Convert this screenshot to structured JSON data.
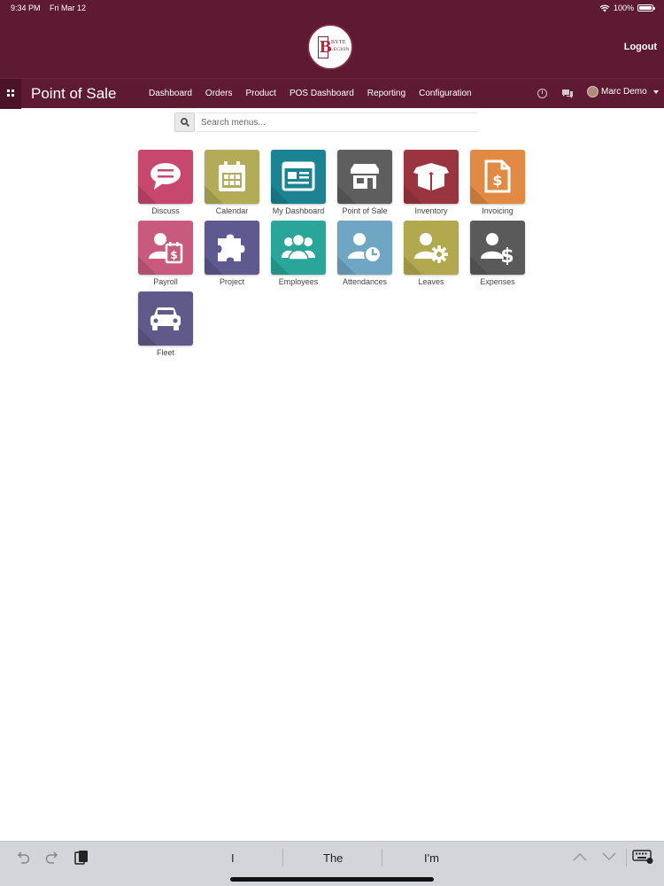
{
  "status": {
    "time": "9:34 PM",
    "date": "Fri Mar 12",
    "battery": "100%",
    "battery_level": 1.0
  },
  "header": {
    "logo_text_line1": "BYTE",
    "logo_text_line2": "LEGION",
    "logo_letter": "B",
    "logout_label": "Logout",
    "brand_color": "#5e1a33"
  },
  "nav": {
    "app_title": "Point of Sale",
    "menu": [
      "Dashboard",
      "Orders",
      "Product",
      "POS Dashboard",
      "Reporting",
      "Configuration"
    ],
    "user_name": "Marc Demo"
  },
  "search": {
    "placeholder": "Search menus..."
  },
  "apps": [
    {
      "label": "Discuss",
      "icon": "speech-bubble-icon",
      "color": "#c7476f"
    },
    {
      "label": "Calendar",
      "icon": "calendar-icon",
      "color": "#b3ab58"
    },
    {
      "label": "My Dashboard",
      "icon": "dashboard-icon",
      "color": "#1b8392"
    },
    {
      "label": "Point of Sale",
      "icon": "store-icon",
      "color": "#5e5e5e"
    },
    {
      "label": "Inventory",
      "icon": "box-icon",
      "color": "#9a353f"
    },
    {
      "label": "Invoicing",
      "icon": "invoice-icon",
      "color": "#e08a44"
    },
    {
      "label": "Payroll",
      "icon": "payroll-icon",
      "color": "#c85a7e"
    },
    {
      "label": "Project",
      "icon": "puzzle-icon",
      "color": "#5e5a8f"
    },
    {
      "label": "Employees",
      "icon": "group-icon",
      "color": "#2aa59a"
    },
    {
      "label": "Attendances",
      "icon": "user-clock-icon",
      "color": "#6fa6c3"
    },
    {
      "label": "Leaves",
      "icon": "user-gear-icon",
      "color": "#b2a84e"
    },
    {
      "label": "Expenses",
      "icon": "user-dollar-icon",
      "color": "#5a5a5a"
    },
    {
      "label": "Fleet",
      "icon": "car-icon",
      "color": "#5f5a89"
    }
  ],
  "keyboard": {
    "suggestions": [
      "I",
      "The",
      "I'm"
    ]
  }
}
